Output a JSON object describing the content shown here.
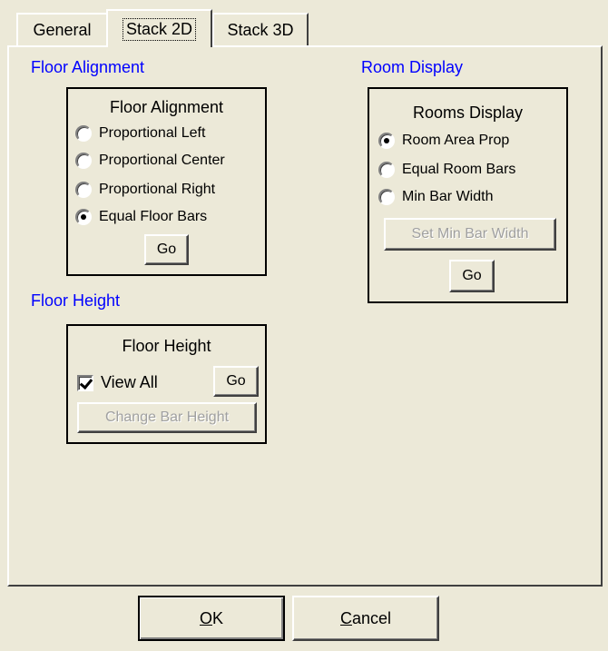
{
  "tabs": [
    {
      "label": "General",
      "selected": false
    },
    {
      "label": "Stack 2D",
      "selected": true
    },
    {
      "label": "Stack 3D",
      "selected": false
    }
  ],
  "floor_alignment": {
    "section_title": "Floor Alignment",
    "group_title": "Floor Alignment",
    "options": [
      {
        "label": "Proportional Left",
        "checked": false
      },
      {
        "label": "Proportional Center",
        "checked": false
      },
      {
        "label": "Proportional Right",
        "checked": false
      },
      {
        "label": "Equal Floor Bars",
        "checked": true
      }
    ],
    "go_label": "Go"
  },
  "room_display": {
    "section_title": "Room Display",
    "group_title": "Rooms Display",
    "options": [
      {
        "label": "Room Area Prop",
        "checked": true
      },
      {
        "label": "Equal Room Bars",
        "checked": false
      },
      {
        "label": "Min Bar Width",
        "checked": false
      }
    ],
    "set_min_bar_width_label": "Set Min Bar Width",
    "go_label": "Go"
  },
  "floor_height": {
    "section_title": "Floor Height",
    "group_title": "Floor Height",
    "view_all_label": "View All",
    "view_all_checked": true,
    "go_label": "Go",
    "change_bar_height_label": "Change Bar Height"
  },
  "footer": {
    "ok_accel": "O",
    "ok_rest": "K",
    "cancel_accel": "C",
    "cancel_rest": "ancel"
  }
}
